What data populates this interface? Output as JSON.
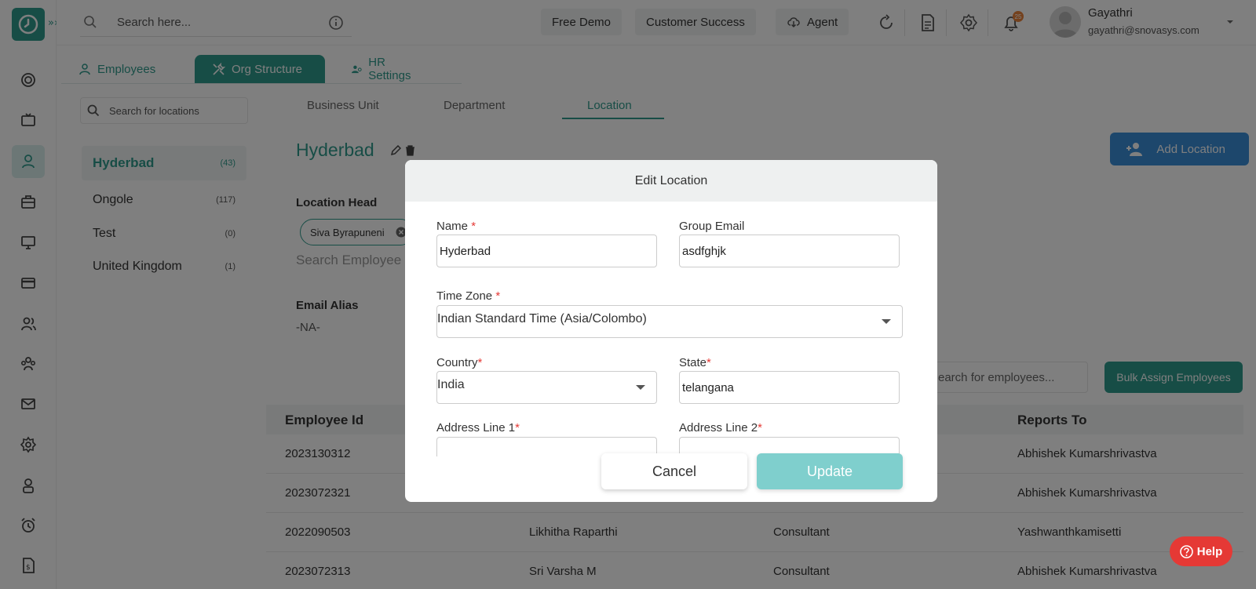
{
  "topbar": {
    "search_placeholder": "Search here...",
    "free_demo": "Free Demo",
    "customer_success": "Customer Success",
    "agent": "Agent",
    "notification_count": "25",
    "user_name": "Gayathri",
    "user_email": "gayathri@snovasys.com"
  },
  "org_tabs": {
    "employees": "Employees",
    "org_structure": "Org Structure",
    "hr_settings": "HR Settings"
  },
  "locations": {
    "search_placeholder": "Search for locations",
    "items": [
      {
        "name": "Hyderbad",
        "count": "(43)"
      },
      {
        "name": "Ongole",
        "count": "(117)"
      },
      {
        "name": "Test",
        "count": "(0)"
      },
      {
        "name": "United Kingdom",
        "count": "(1)"
      }
    ]
  },
  "sub_tabs": {
    "business_unit": "Business Unit",
    "department": "Department",
    "location": "Location"
  },
  "detail": {
    "title": "Hyderbad",
    "location_head_label": "Location Head",
    "location_head_chip": "Siva Byrapuneni",
    "search_employees_placeholder": "Search Employee",
    "email_alias_label": "Email Alias",
    "email_alias_value": "-NA-",
    "add_location": "Add Location",
    "bulk_assign": "Bulk Assign Employees",
    "employees_search": "earch for employees..."
  },
  "table": {
    "headers": {
      "employee_id": "Employee Id",
      "reports_to": "Reports To"
    },
    "rows": [
      {
        "id": "2023130312",
        "name": "",
        "designation": "",
        "reports_to": "Abhishek Kumarshrivastva"
      },
      {
        "id": "2023072321",
        "name": "",
        "designation": "",
        "reports_to": "Abhishek Kumarshrivastva"
      },
      {
        "id": "2022090503",
        "name": "Likhitha Raparthi",
        "designation": "Consultant",
        "reports_to": "Yashwanthkamisetti"
      },
      {
        "id": "2023072313",
        "name": "Sri Varsha M",
        "designation": "Consultant",
        "reports_to": "Abhishek Kumarshrivastva"
      }
    ]
  },
  "help": "Help",
  "modal": {
    "title": "Edit Location",
    "name_label": "Name",
    "name_value": "Hyderbad",
    "group_email_label": "Group Email",
    "group_email_value": "asdfghjk",
    "timezone_label": "Time Zone",
    "timezone_value": "Indian Standard Time (Asia/Colombo)",
    "country_label": "Country",
    "country_value": "India",
    "state_label": "State",
    "state_value": "telangana",
    "address1_label": "Address Line 1",
    "address2_label": "Address Line 2",
    "required_mark": "*",
    "cancel": "Cancel",
    "update": "Update"
  },
  "colors": {
    "brand": "#2f9a8c",
    "update_button": "#7fcfcd",
    "required": "#e53935",
    "help": "#e53935"
  }
}
